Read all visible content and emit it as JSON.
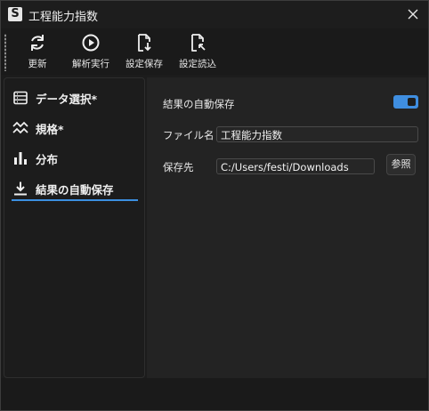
{
  "window": {
    "logo_letter": "S",
    "title": "工程能力指数"
  },
  "toolbar": {
    "refresh_label": "更新",
    "analyze_label": "解析実行",
    "save_settings_label": "設定保存",
    "load_settings_label": "設定読込"
  },
  "sidebar": {
    "items": [
      {
        "label": "データ選択*",
        "icon": "table-icon"
      },
      {
        "label": "規格*",
        "icon": "wave-icon"
      },
      {
        "label": "分布",
        "icon": "bar-chart-icon"
      },
      {
        "label": "結果の自動保存",
        "icon": "download-icon"
      }
    ]
  },
  "autosave": {
    "toggle_label": "結果の自動保存",
    "toggle_on": true,
    "filename_label": "ファイル名",
    "filename_value": "工程能力指数",
    "destination_label": "保存先",
    "destination_value": "C:/Users/festi/Downloads",
    "browse_label": "参照"
  },
  "colors": {
    "accent": "#3b8fe0",
    "background": "#1c1c1c",
    "panel": "#232323"
  }
}
